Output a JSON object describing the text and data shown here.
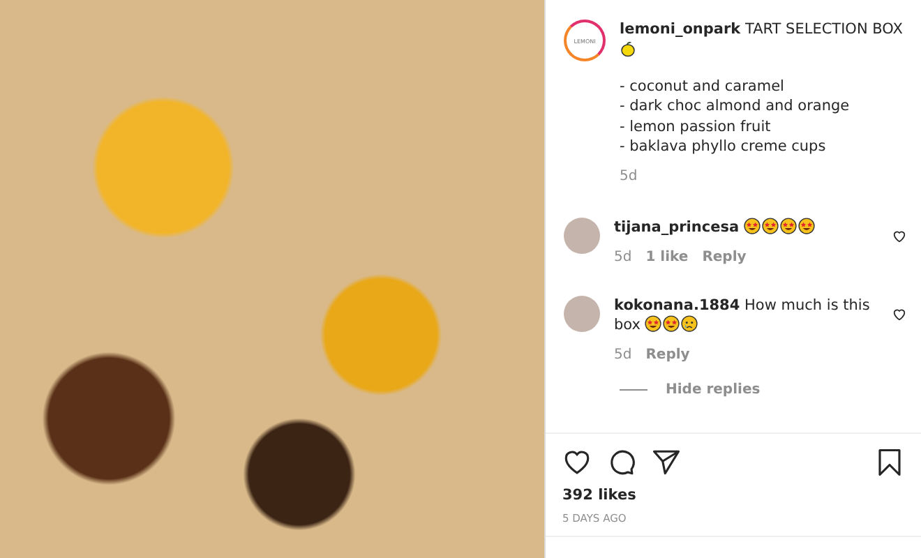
{
  "post": {
    "username": "lemoni_onpark",
    "avatar_text": "LEMONI",
    "caption_title": "TART SELECTION BOX",
    "caption_emojis": [
      {
        "kind": "lemon"
      }
    ],
    "caption_lines": [
      "- coconut and caramel",
      "- dark choc almond and orange",
      "- lemon passion fruit",
      "- baklava phyllo creme cups"
    ],
    "age": "5d"
  },
  "comments": [
    {
      "username": "tijana_princesa",
      "emojis": [
        {
          "kind": "star-eyes"
        },
        {
          "kind": "star-eyes"
        },
        {
          "kind": "star-eyes"
        },
        {
          "kind": "star-eyes"
        }
      ],
      "age": "5d",
      "likes": "1 like",
      "reply": "Reply"
    },
    {
      "username": "kokonana.1884",
      "text": "How much is this box",
      "emojis": [
        {
          "kind": "star-eyes"
        },
        {
          "kind": "star-eyes"
        },
        {
          "kind": "crying"
        }
      ],
      "age": "5d",
      "reply": "Reply"
    }
  ],
  "hide_replies": "Hide replies",
  "likes": "392 likes",
  "posted": "5 DAYS AGO"
}
